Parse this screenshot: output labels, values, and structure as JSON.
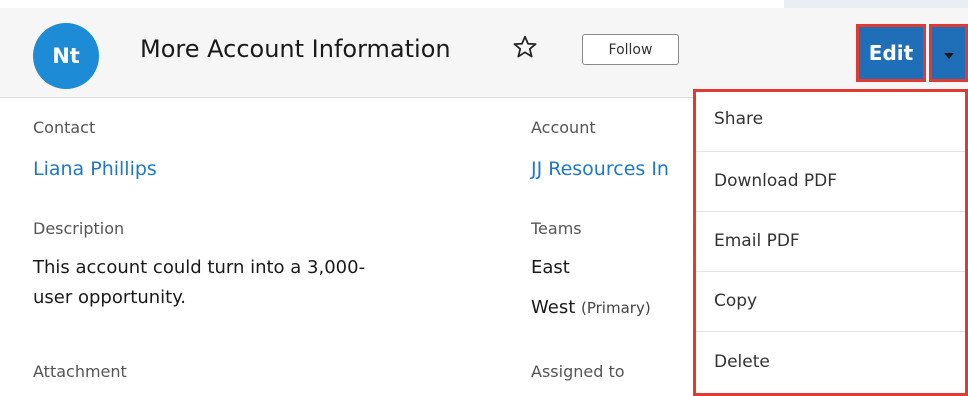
{
  "header": {
    "avatar_initials": "Nt",
    "title": "More Account Information",
    "follow_label": "Follow",
    "edit_label": "Edit"
  },
  "fields": {
    "contact_label": "Contact",
    "contact_value": "Liana Phillips",
    "account_label": "Account",
    "account_value": "JJ Resources In",
    "description_label": "Description",
    "description_line1": "This account could turn into a 3,000-",
    "description_line2": "user opportunity.",
    "teams_label": "Teams",
    "team_1": "East",
    "team_2": "West",
    "team_2_suffix": "(Primary)",
    "attachment_label": "Attachment",
    "assigned_label": "Assigned to"
  },
  "menu": {
    "items": [
      "Share",
      "Download PDF",
      "Email PDF",
      "Copy",
      "Delete"
    ]
  },
  "colors": {
    "accent": "#1e6fb8",
    "avatar": "#1d8bd6",
    "link": "#1e78c8",
    "highlight": "#e23a2e"
  },
  "icons": {
    "star": "star-outline-icon",
    "caret": "caret-down-icon"
  }
}
